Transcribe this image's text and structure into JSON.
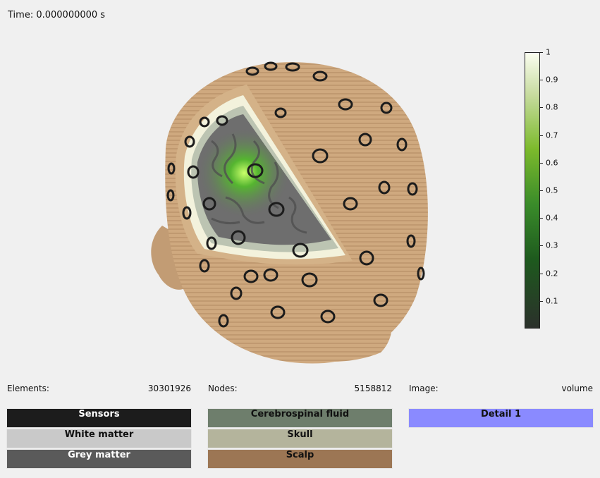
{
  "time_label": "Time: 0.000000000 s",
  "colorbar": {
    "ticks": [
      "1",
      "0.9",
      "0.8",
      "0.7",
      "0.6",
      "0.5",
      "0.4",
      "0.3",
      "0.2",
      "0.1"
    ],
    "colors": [
      "#2b302b",
      "#1e5a1e",
      "#3a8c2a",
      "#7cba2c",
      "#c8dca0",
      "#fbfdf0"
    ]
  },
  "info": {
    "elements_label": "Elements:",
    "elements_value": "30301926",
    "nodes_label": "Nodes:",
    "nodes_value": "5158812",
    "image_label": "Image:",
    "image_value": "volume"
  },
  "buttons": {
    "sensors": "Sensors",
    "white_matter": "White matter",
    "grey_matter": "Grey matter",
    "csf": "Cerebrospinal fluid",
    "skull": "Skull",
    "scalp": "Scalp",
    "detail1": "Detail 1"
  },
  "colors": {
    "sensors": "#1c1c1c",
    "white_matter": "#c9c9c9",
    "grey_matter": "#5a5a5a",
    "csf": "#6e7e6c",
    "skull": "#b4b49c",
    "scalp": "#9c7654",
    "detail1": "#8a8aff"
  }
}
